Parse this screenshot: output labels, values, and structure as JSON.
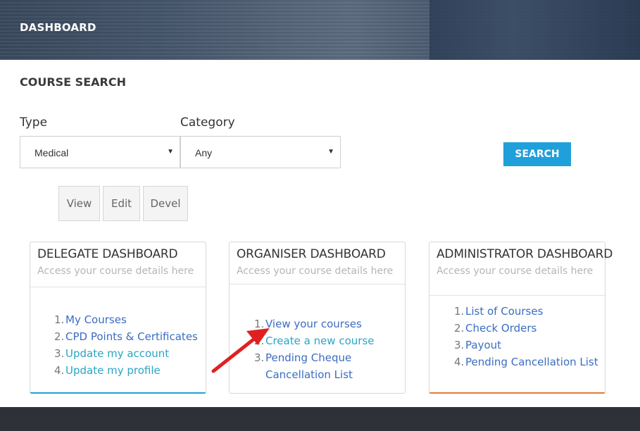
{
  "header": {
    "title": "DASHBOARD"
  },
  "search": {
    "title": "COURSE SEARCH",
    "type_label": "Type",
    "type_value": "Medical",
    "category_label": "Category",
    "category_value": "Any",
    "button": "SEARCH"
  },
  "tabs": [
    "View",
    "Edit",
    "Devel"
  ],
  "panels": {
    "delegate": {
      "title": "DELEGATE DASHBOARD",
      "subtitle": "Access your course details here",
      "items": [
        {
          "num": "1.",
          "label": "My Courses"
        },
        {
          "num": "2.",
          "label": "CPD Points & Certificates"
        },
        {
          "num": "3.",
          "label": "Update my account"
        },
        {
          "num": "4.",
          "label": "Update my profile"
        }
      ],
      "accent": "#1fa0db"
    },
    "organiser": {
      "title": "ORGANISER DASHBOARD",
      "subtitle": "Access your course details here",
      "items": [
        {
          "num": "1.",
          "label": "View your courses"
        },
        {
          "num": "2.",
          "label": "Create a new course"
        },
        {
          "num": "3.",
          "label": "Pending Cheque",
          "label2": "Cancellation List"
        }
      ]
    },
    "administrator": {
      "title": "ADMINISTRATOR DASHBOARD",
      "subtitle": "Access your course details here",
      "items": [
        {
          "num": "1.",
          "label": "List of Courses"
        },
        {
          "num": "2.",
          "label": "Check Orders"
        },
        {
          "num": "3.",
          "label": "Payout"
        },
        {
          "num": "4.",
          "label": "Pending Cancellation List"
        }
      ],
      "accent": "#e8772e"
    }
  },
  "colors": {
    "accent_blue": "#1fa0db",
    "link_blue": "#3b6cc2",
    "link_teal": "#2aa5c2",
    "arrow_red": "#e02020"
  },
  "icons": {
    "dropdown": "chevron-down-icon",
    "annotation": "red-arrow-icon"
  }
}
